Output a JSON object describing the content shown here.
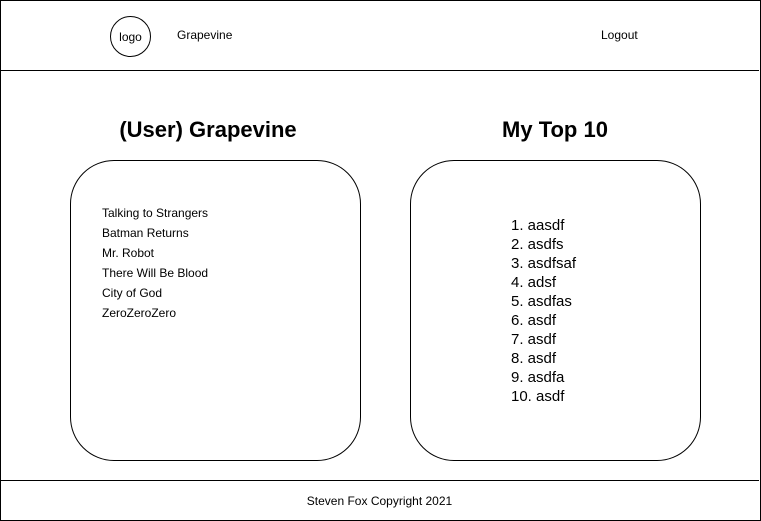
{
  "header": {
    "logo_label": "logo",
    "brand": "Grapevine",
    "logout_label": "Logout"
  },
  "grapevine": {
    "title": "(User) Grapevine",
    "items": [
      "Talking to Strangers",
      "Batman Returns",
      "Mr. Robot",
      "There Will Be Blood",
      "City of God",
      "ZeroZeroZero"
    ]
  },
  "top10": {
    "title": "My Top 10",
    "items": [
      "1. aasdf",
      "2. asdfs",
      "3. asdfsaf",
      "4. adsf",
      "5. asdfas",
      "6. asdf",
      "7. asdf",
      "8. asdf",
      "9. asdfa",
      "10. asdf"
    ]
  },
  "footer": {
    "text": "Steven Fox Copyright 2021"
  }
}
